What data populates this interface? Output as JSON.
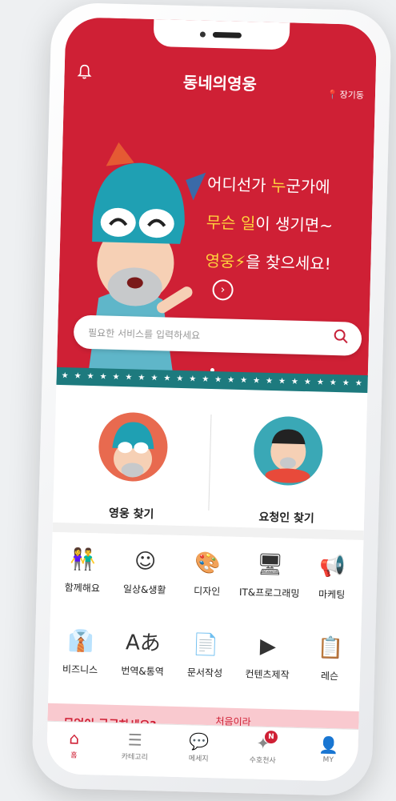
{
  "header": {
    "title": "동네의영웅",
    "location": "장기동",
    "bell_icon": "bell-icon",
    "pin_icon": "location-pin-icon"
  },
  "hero": {
    "tagline": [
      {
        "a": "어디선가 ",
        "hl": "누",
        "b": "군가에"
      },
      {
        "a": "",
        "hl": "무슨 일",
        "b": "이 생기면~"
      },
      {
        "a": "",
        "hl": "영웅⚡",
        "b": "을 찾으세요!"
      }
    ],
    "bg_color": "#cf2035"
  },
  "search": {
    "placeholder": "필요한 서비스를 입력하세요",
    "icon": "search-icon"
  },
  "find": {
    "hero_label": "영웅 찾기",
    "requester_label": "요청인 찾기"
  },
  "categories": [
    {
      "label": "함께해요",
      "icon": "together-icon"
    },
    {
      "label": "일상&생활",
      "icon": "daily-life-icon"
    },
    {
      "label": "디자인",
      "icon": "palette-icon"
    },
    {
      "label": "IT&프로그래밍",
      "icon": "monitor-icon"
    },
    {
      "label": "마케팅",
      "icon": "megaphone-icon"
    },
    {
      "label": "비즈니스",
      "icon": "business-shirt-icon"
    },
    {
      "label": "번역&통역",
      "icon": "translate-icon"
    },
    {
      "label": "문서작성",
      "icon": "document-icon"
    },
    {
      "label": "컨텐츠제작",
      "icon": "play-icon"
    },
    {
      "label": "레슨",
      "icon": "lesson-board-icon"
    }
  ],
  "banner": {
    "question": "무엇이 궁금하세요?",
    "sub": "처음이라"
  },
  "tabbar": {
    "home": "홈",
    "category": "카테고리",
    "message": "메세지",
    "guardian": "수호천사",
    "guardian_badge": "N",
    "my": "MY"
  }
}
